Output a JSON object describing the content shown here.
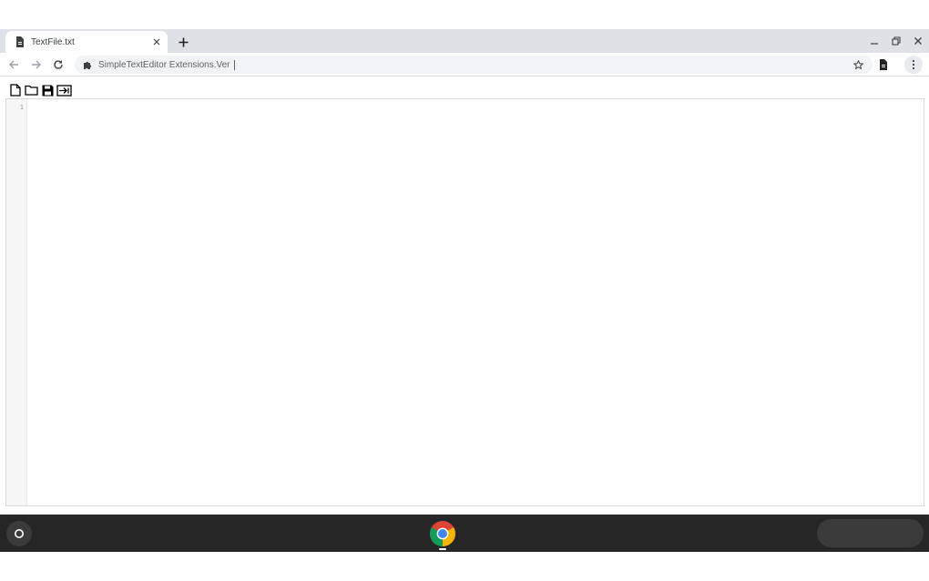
{
  "browser": {
    "tab": {
      "title": "TextFile.txt",
      "favicon": "document-icon"
    },
    "new_tab_icon": "plus-icon",
    "window_controls": [
      "minimize-icon",
      "restore-icon",
      "close-icon"
    ],
    "omnibox": {
      "extension_icon": "puzzle-piece-icon",
      "text": "SimpleTextEditor Extensions.Ver"
    }
  },
  "editor": {
    "toolbar_icons": [
      "new-file-icon",
      "open-folder-icon",
      "save-icon",
      "export-icon"
    ],
    "line_numbers": [
      "1"
    ],
    "content": ""
  },
  "shelf": {
    "launcher_icon": "launcher-circle-icon",
    "pinned_app_icon": "chrome-icon"
  },
  "colors": {
    "tabstrip": "#dee1e6",
    "omnibox": "#f1f3f4",
    "shelf": "#262626",
    "chrome_red": "#db4437",
    "chrome_yellow": "#f4b400",
    "chrome_green": "#0f9d58",
    "chrome_blue": "#4285f4"
  }
}
